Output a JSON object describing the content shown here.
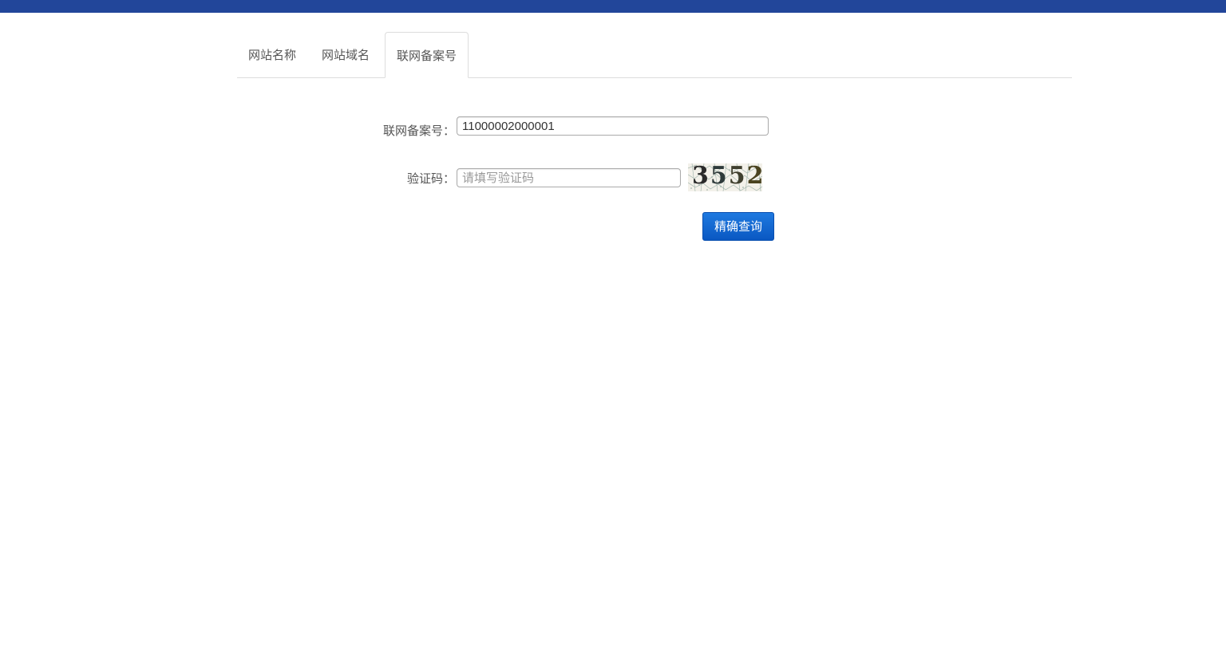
{
  "header": {
    "bar_color": "#22469a"
  },
  "tabs": [
    {
      "label": "网站名称",
      "active": false
    },
    {
      "label": "网站域名",
      "active": false
    },
    {
      "label": "联网备案号",
      "active": true
    }
  ],
  "form": {
    "record_label": "联网备案号：",
    "record_value": "11000002000001",
    "captcha_label": "验证码：",
    "captcha_placeholder": "请填写验证码",
    "captcha_image_text": "3552",
    "submit_label": "精确查询"
  },
  "colors": {
    "accent": "#0a63d1",
    "tab_border": "#dddddd"
  }
}
